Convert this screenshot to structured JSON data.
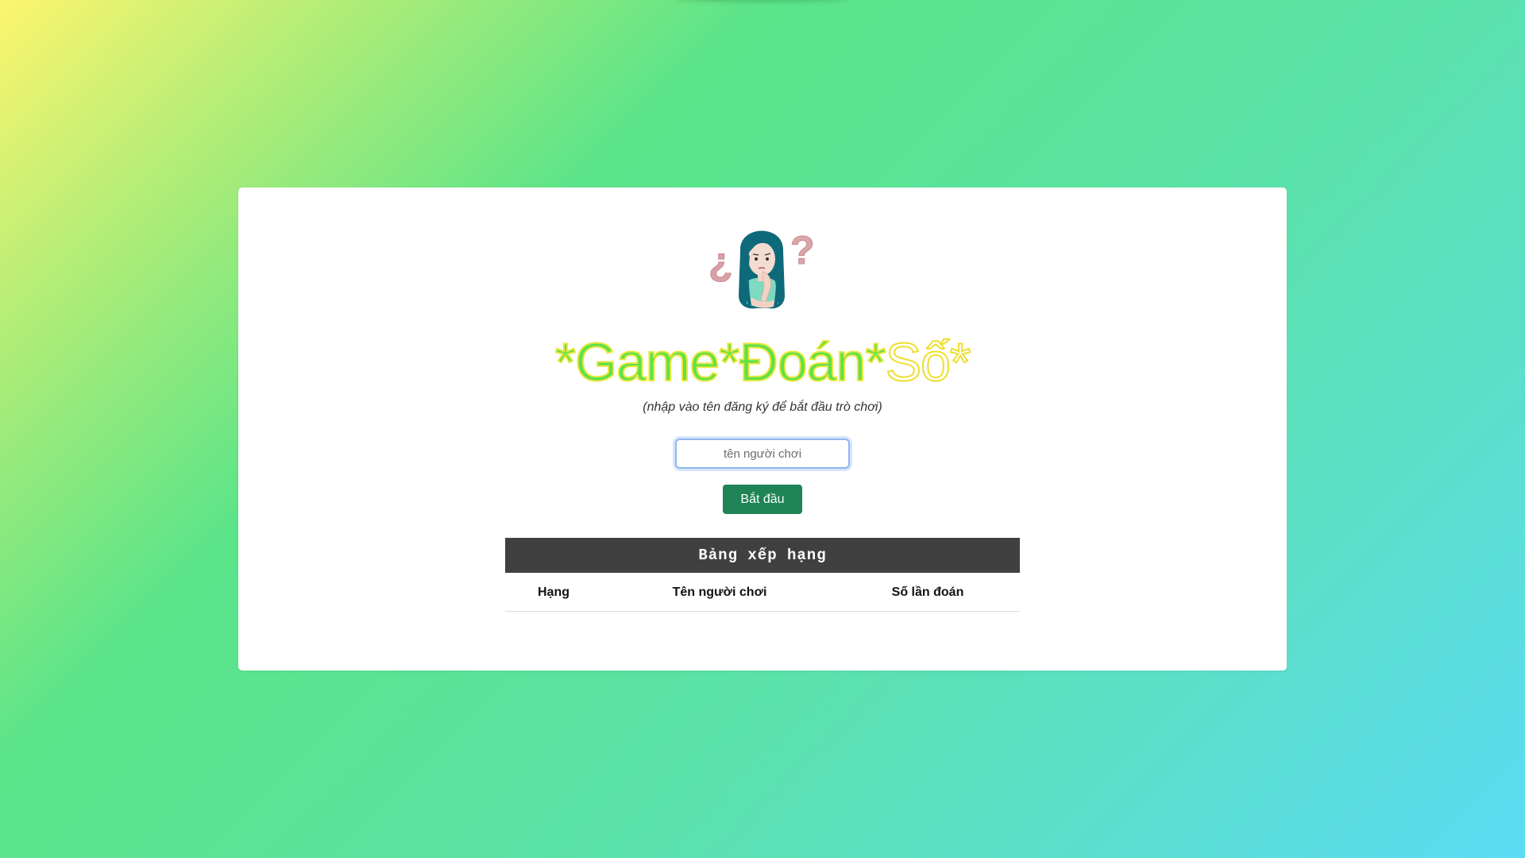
{
  "page": {
    "title_parts": [
      "*Game*Đoán*",
      "Số*"
    ],
    "subtitle": "(nhập vào tên đăng ký để bắt đầu trò chơi)",
    "avatar_icon": "thinking-girl-with-question-marks"
  },
  "form": {
    "name_placeholder": "tên người chơi",
    "name_value": "",
    "start_label": "Bắt đầu"
  },
  "ranking": {
    "title": "Bảng xếp hạng",
    "columns": [
      "Hạng",
      "Tên người chơi",
      "Số lần đoán"
    ],
    "rows": []
  },
  "colors": {
    "title_fill": "#5be24a",
    "title_outline": "#e9e63a",
    "button": "#1e8455",
    "table_header": "#404040"
  }
}
